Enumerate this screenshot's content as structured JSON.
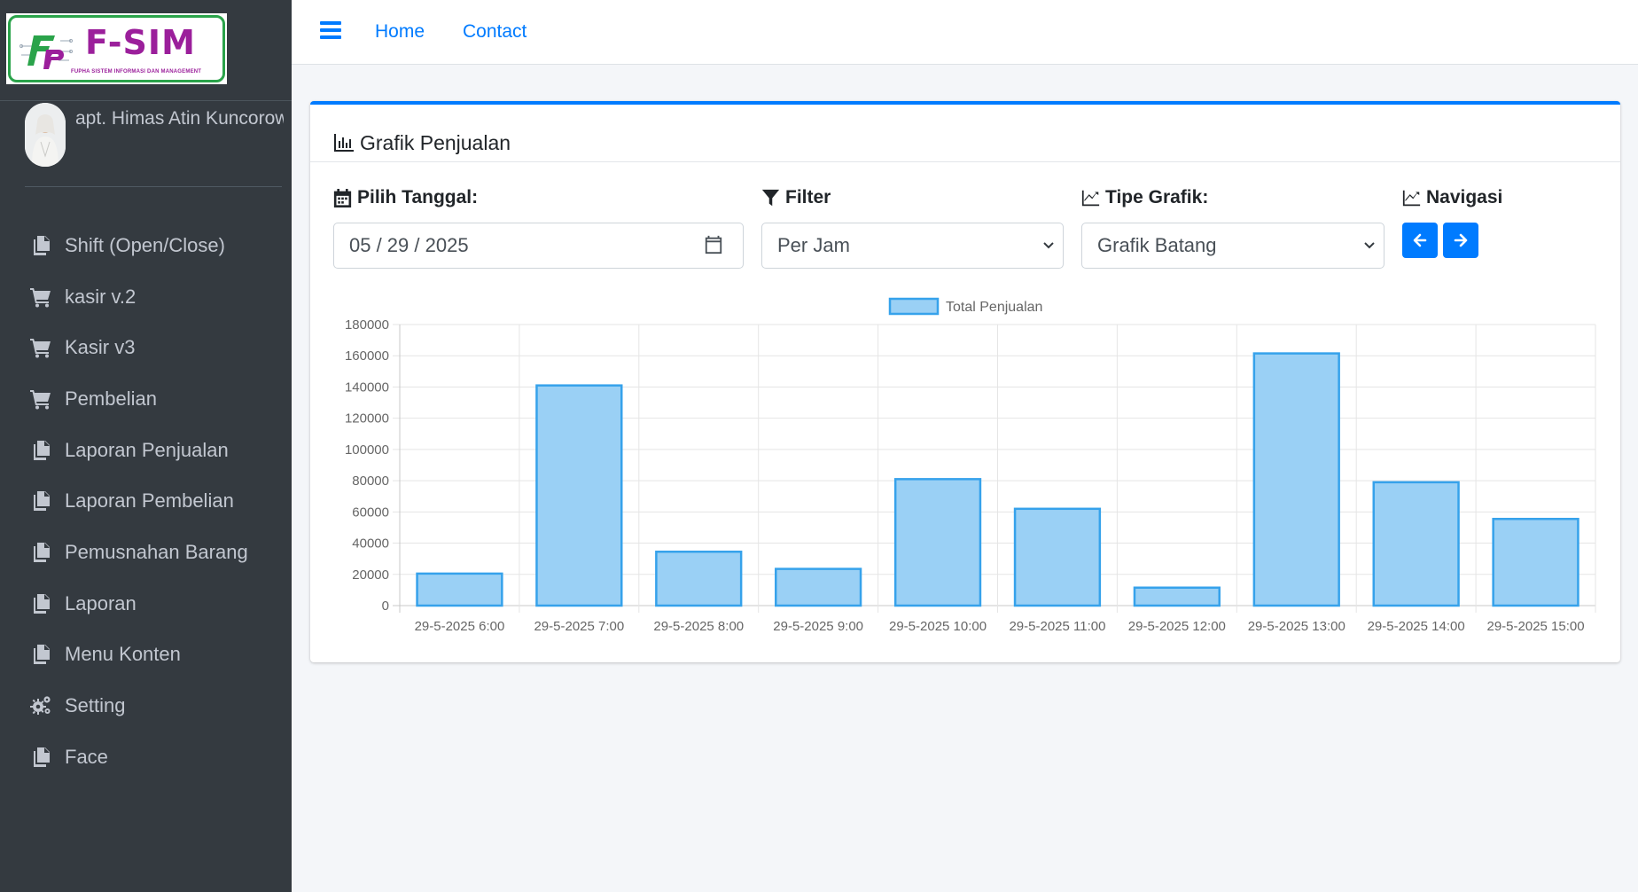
{
  "brand": {
    "logo_title": "F-SIM",
    "logo_subtitle": "FUPHA SISTEM INFORMASI DAN MANAGEMENT"
  },
  "user": {
    "name": "apt. Himas Atin Kuncorowati"
  },
  "sidebar": {
    "items": [
      {
        "label": "Shift (Open/Close)",
        "icon": "copy-icon"
      },
      {
        "label": "kasir v.2",
        "icon": "cart-icon"
      },
      {
        "label": "Kasir v3",
        "icon": "cart-icon"
      },
      {
        "label": "Pembelian",
        "icon": "cart-icon"
      },
      {
        "label": "Laporan Penjualan",
        "icon": "copy-icon"
      },
      {
        "label": "Laporan Pembelian",
        "icon": "copy-icon"
      },
      {
        "label": "Pemusnahan Barang",
        "icon": "copy-icon"
      },
      {
        "label": "Laporan",
        "icon": "copy-icon"
      },
      {
        "label": "Menu Konten",
        "icon": "copy-icon"
      },
      {
        "label": "Setting",
        "icon": "cogs-icon"
      },
      {
        "label": "Face",
        "icon": "copy-icon"
      }
    ]
  },
  "navbar": {
    "home": "Home",
    "contact": "Contact"
  },
  "card": {
    "title": "Grafik Penjualan",
    "date_label": "Pilih Tanggal:",
    "date_value": "05 / 29 / 2025",
    "filter_label": "Filter",
    "filter_value": "Per Jam",
    "type_label": "Tipe Grafik:",
    "type_value": "Grafik Batang",
    "nav_label": "Navigasi"
  },
  "colors": {
    "accent": "#007bff",
    "bar_fill": "#9ad0f5",
    "bar_stroke": "#36a2eb",
    "sidebar_bg": "#343a40"
  },
  "chart_data": {
    "type": "bar",
    "categories": [
      "29-5-2025 6:00",
      "29-5-2025 7:00",
      "29-5-2025 8:00",
      "29-5-2025 9:00",
      "29-5-2025 10:00",
      "29-5-2025 11:00",
      "29-5-2025 12:00",
      "29-5-2025 13:00",
      "29-5-2025 14:00",
      "29-5-2025 15:00"
    ],
    "series": [
      {
        "name": "Total Penjualan",
        "values": [
          20500,
          141000,
          34500,
          23500,
          81000,
          62000,
          11500,
          161500,
          79000,
          55500
        ]
      }
    ],
    "ylim": [
      0,
      180000
    ],
    "yticks": [
      0,
      20000,
      40000,
      60000,
      80000,
      100000,
      120000,
      140000,
      160000,
      180000
    ],
    "grid": true,
    "legend": "top-center"
  }
}
